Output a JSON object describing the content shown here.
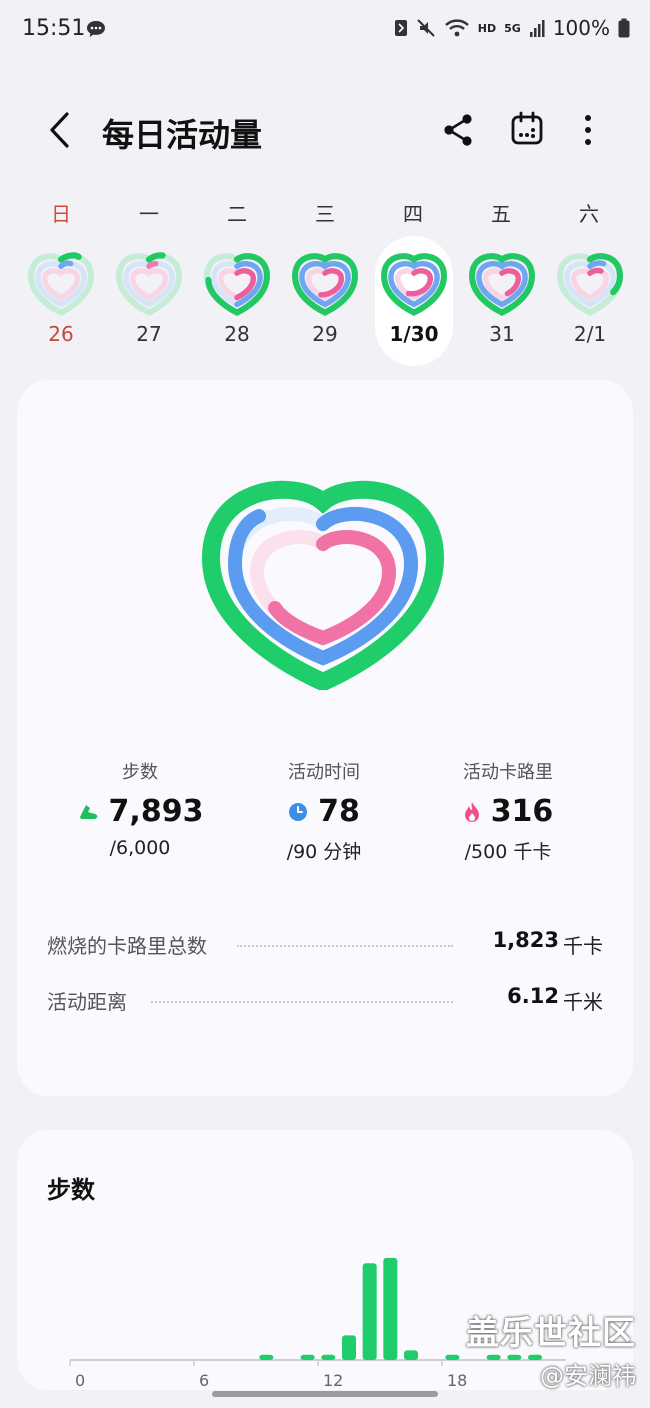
{
  "status_bar": {
    "time": "15:51",
    "network": "HD",
    "signal": "5G",
    "battery": "100%"
  },
  "header": {
    "title": "每日活动量",
    "icons": [
      "back-icon",
      "share-icon",
      "calendar-icon",
      "more-vert-icon"
    ]
  },
  "week": {
    "days": [
      {
        "weekday": "日",
        "date": "26"
      },
      {
        "weekday": "一",
        "date": "27"
      },
      {
        "weekday": "二",
        "date": "28"
      },
      {
        "weekday": "三",
        "date": "29"
      },
      {
        "weekday": "四",
        "date": "1/30"
      },
      {
        "weekday": "五",
        "date": "31"
      },
      {
        "weekday": "六",
        "date": "2/1"
      }
    ],
    "selected_date": "1/30"
  },
  "summary": {
    "stats": [
      {
        "label": "步数",
        "value": "7,893",
        "goal": "/6,000",
        "icon": "shoe-icon",
        "color": "#1fbf5c"
      },
      {
        "label": "活动时间",
        "value": "78",
        "goal": "/90 分钟",
        "icon": "clock-icon",
        "color": "#3b8fe6"
      },
      {
        "label": "活动卡路里",
        "value": "316",
        "goal": "/500 千卡",
        "icon": "flame-icon",
        "color": "#ef4f8f"
      }
    ],
    "details": [
      {
        "label": "燃烧的卡路里总数",
        "value": "1,823",
        "unit": "千卡"
      },
      {
        "label": "活动距离",
        "value": "6.12",
        "unit": "千米"
      }
    ]
  },
  "colors": {
    "steps_ring": "#1fce6a",
    "time_ring": "#5b9cf0",
    "calorie_ring": "#f072a6",
    "sunday": "#d4483a"
  },
  "steps_chart": {
    "title": "步数",
    "chart_data": {
      "type": "bar",
      "title": "步数",
      "x_ticks": [
        "0",
        "6",
        "12",
        "18"
      ],
      "xlim": [
        0,
        24
      ],
      "hours": [
        9,
        11,
        12,
        13,
        14,
        15,
        16,
        18,
        20,
        21,
        22
      ],
      "values": [
        60,
        60,
        60,
        280,
        1100,
        1160,
        110,
        60,
        60,
        60,
        60
      ],
      "ylim": [
        0,
        1250
      ],
      "bar_color": "#1fce6a"
    }
  },
  "watermark": {
    "line1": "盖乐世社区",
    "line2": "@安澜祎"
  }
}
